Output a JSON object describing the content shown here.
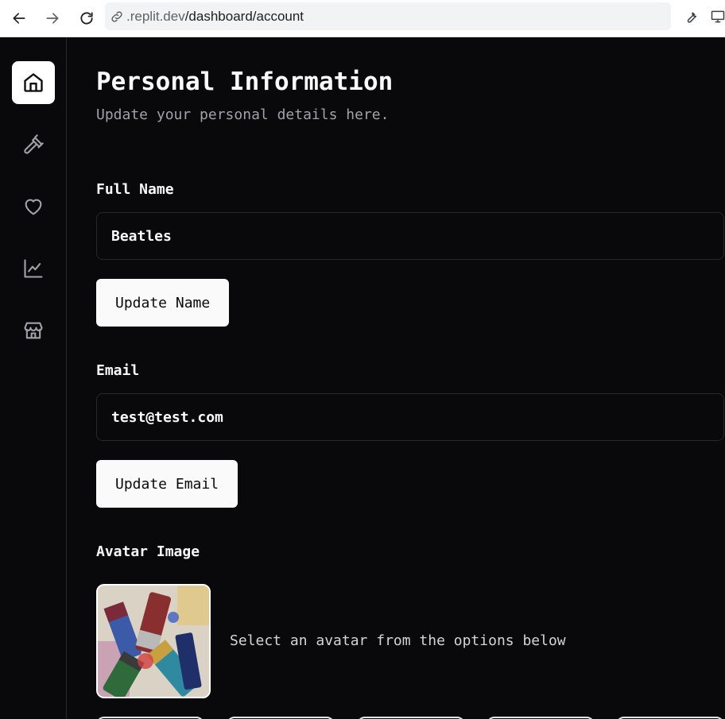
{
  "browser": {
    "url_domain": ".replit.dev",
    "url_path": "/dashboard/account",
    "icons": [
      "back-arrow-icon",
      "forward-arrow-icon",
      "reload-icon",
      "link-icon",
      "wrench-icon",
      "monitor-icon"
    ]
  },
  "sidebar": {
    "items": [
      {
        "name": "home",
        "icon": "home-icon",
        "active": true
      },
      {
        "name": "tools",
        "icon": "hammer-icon",
        "active": false
      },
      {
        "name": "favorites",
        "icon": "heart-icon",
        "active": false
      },
      {
        "name": "analytics",
        "icon": "line-chart-icon",
        "active": false
      },
      {
        "name": "store",
        "icon": "store-icon",
        "active": false
      }
    ]
  },
  "main": {
    "title": "Personal Information",
    "subtitle": "Update your personal details here.",
    "full_name": {
      "label": "Full Name",
      "value": "Beatles",
      "button": "Update Name"
    },
    "email": {
      "label": "Email",
      "value": "test@test.com",
      "button": "Update Email"
    },
    "avatar": {
      "label": "Avatar Image",
      "hint": "Select an avatar from the options below"
    }
  },
  "colors": {
    "background": "#09090b",
    "border": "#27272a",
    "text": "#fafafa",
    "muted_text": "#a1a1aa",
    "button_bg": "#fafafa",
    "button_text": "#09090b"
  }
}
